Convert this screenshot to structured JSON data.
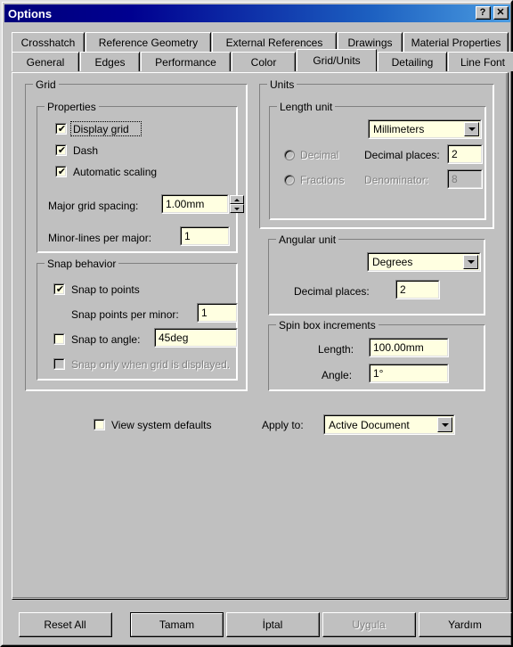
{
  "window": {
    "title": "Options",
    "help_button": "?",
    "close_button": "✕"
  },
  "tabs": {
    "row1": [
      {
        "label": "Crosshatch",
        "selected": false
      },
      {
        "label": "Reference Geometry",
        "selected": false
      },
      {
        "label": "External References",
        "selected": false
      },
      {
        "label": "Drawings",
        "selected": false
      },
      {
        "label": "Material Properties",
        "selected": false
      }
    ],
    "row2": [
      {
        "label": "General",
        "selected": false
      },
      {
        "label": "Edges",
        "selected": false
      },
      {
        "label": "Performance",
        "selected": false
      },
      {
        "label": "Color",
        "selected": false
      },
      {
        "label": "Grid/Units",
        "selected": true
      },
      {
        "label": "Detailing",
        "selected": false
      },
      {
        "label": "Line Font",
        "selected": false
      }
    ]
  },
  "grid": {
    "legend": "Grid",
    "properties": {
      "legend": "Properties",
      "display_grid": {
        "label": "Display grid",
        "checked": true,
        "enabled": true,
        "focused": true
      },
      "dash": {
        "label": "Dash",
        "checked": true,
        "enabled": true
      },
      "automatic_scaling": {
        "label": "Automatic scaling",
        "checked": true,
        "enabled": true
      },
      "major_grid_spacing": {
        "label": "Major grid spacing:",
        "value": "1.00mm"
      },
      "minor_lines_per_major": {
        "label": "Minor-lines per major:",
        "value": "1"
      }
    },
    "snap_behavior": {
      "legend": "Snap behavior",
      "snap_to_points": {
        "label": "Snap to points",
        "checked": true,
        "enabled": true
      },
      "snap_points_per_minor": {
        "label": "Snap points per minor:",
        "value": "1"
      },
      "snap_to_angle": {
        "label": "Snap to angle:",
        "checked": false,
        "enabled": true,
        "value": "45deg"
      },
      "snap_only_when_grid_displayed": {
        "label": "Snap only when grid is displayed.",
        "checked": false,
        "enabled": false
      }
    }
  },
  "units": {
    "legend": "Units",
    "length_unit": {
      "legend": "Length unit",
      "selected": "Millimeters",
      "options": [
        "Millimeters"
      ],
      "decimal": {
        "label": "Decimal",
        "selected": false,
        "enabled": false
      },
      "fractions": {
        "label": "Fractions",
        "selected": false,
        "enabled": false
      },
      "decimal_places": {
        "label": "Decimal places:",
        "value": "2",
        "enabled": true
      },
      "denominator": {
        "label": "Denominator:",
        "value": "8",
        "enabled": false
      }
    },
    "angular_unit": {
      "legend": "Angular unit",
      "selected": "Degrees",
      "options": [
        "Degrees"
      ],
      "decimal_places": {
        "label": "Decimal places:",
        "value": "2"
      }
    },
    "spin_box_increments": {
      "legend": "Spin box increments",
      "length": {
        "label": "Length:",
        "value": "100.00mm"
      },
      "angle": {
        "label": "Angle:",
        "value": "1°"
      }
    }
  },
  "footer": {
    "view_system_defaults": {
      "label": "View system defaults",
      "checked": false
    },
    "apply_to": {
      "label": "Apply to:",
      "selected": "Active Document",
      "options": [
        "Active Document"
      ]
    }
  },
  "buttons": {
    "reset_all": {
      "label": "Reset All",
      "enabled": true,
      "default": false
    },
    "ok": {
      "label": "Tamam",
      "enabled": true,
      "default": true
    },
    "cancel": {
      "label": "İptal",
      "enabled": true,
      "default": false
    },
    "apply": {
      "label": "Uygula",
      "enabled": false,
      "default": false
    },
    "help": {
      "label": "Yardım",
      "enabled": true,
      "default": false
    }
  },
  "colors": {
    "face": "#c0c0c0",
    "field": "#ffffe1",
    "title_start": "#00007b",
    "title_end": "#4a9be0",
    "disabled_text": "#808080"
  }
}
